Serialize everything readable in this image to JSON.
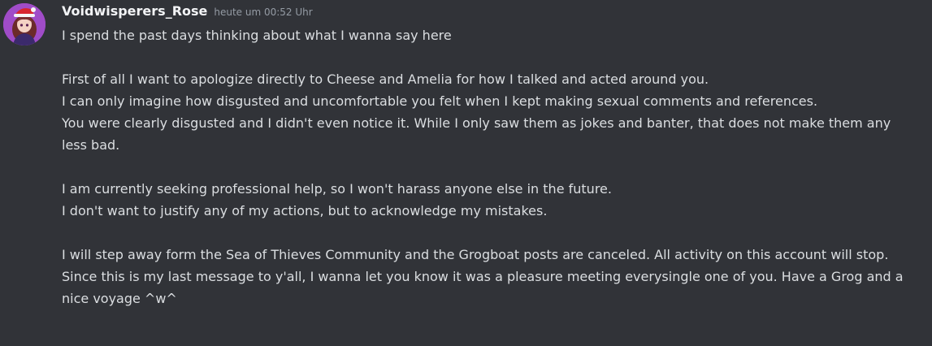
{
  "theme": {
    "background": "#313338",
    "username_color": "#f2f3f5",
    "text_color": "#dbdee1",
    "timestamp_color": "#949ba4"
  },
  "message": {
    "avatar": {
      "icon": "user-avatar-icon"
    },
    "username": "Voidwisperers_Rose",
    "timestamp": "heute um 00:52 Uhr",
    "text": "I spend the past days thinking about what I wanna say here\n\nFirst of all I want to apologize directly to Cheese and Amelia for how I talked and acted around you.\nI can only imagine how disgusted and uncomfortable you felt when I kept making sexual comments and references.\nYou were clearly disgusted and I didn't even notice it. While I only saw them as jokes and banter, that does not make them any less bad.\n\nI am currently seeking professional help, so I won't harass anyone else in the future.\nI don't want to justify any of my actions, but to acknowledge my mistakes.\n\nI will step away form the Sea of Thieves Community and the Grogboat posts are canceled. All activity on this account will stop.\nSince this is my last message to y'all, I wanna let you know it was a pleasure meeting everysingle one of you. Have a Grog and a nice voyage ^w^"
  }
}
